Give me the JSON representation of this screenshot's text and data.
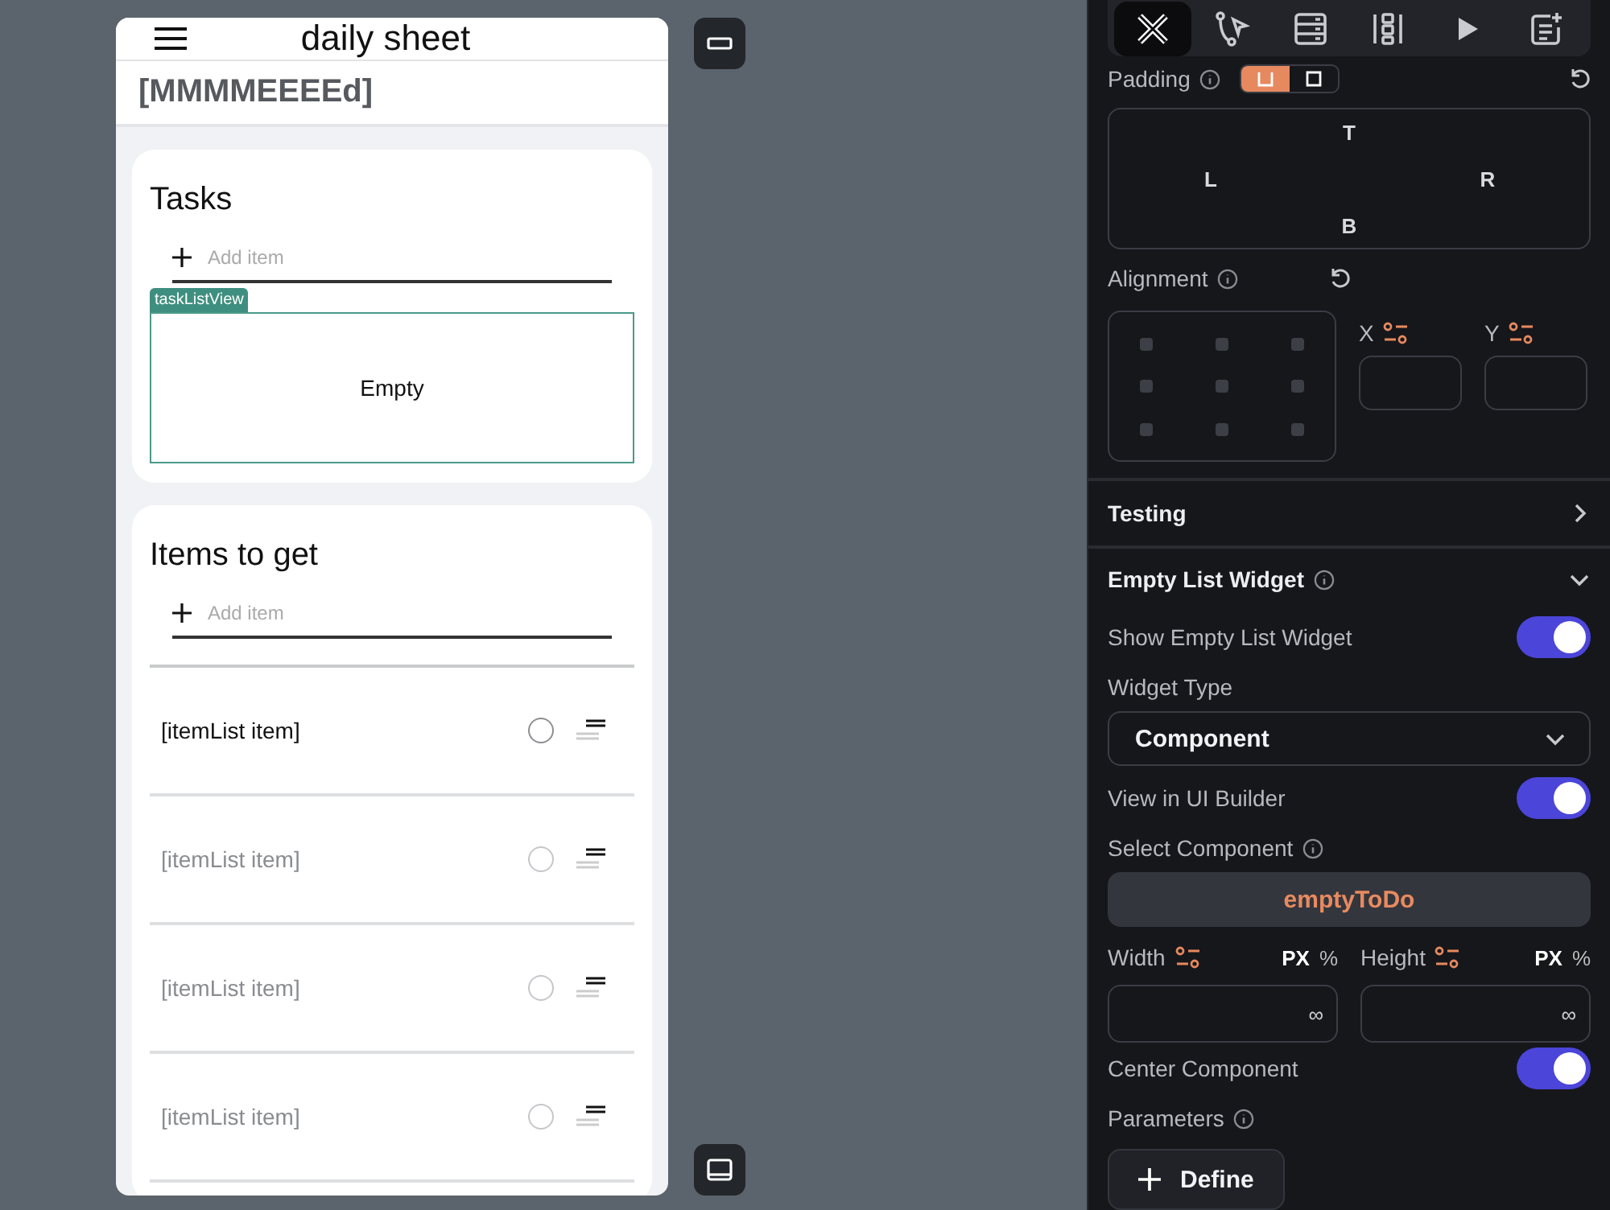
{
  "app_bar": {
    "title": "daily sheet"
  },
  "date_header": "[MMMMEEEEd]",
  "cards": [
    {
      "title": "Tasks",
      "add_placeholder": "Add item",
      "list_tag": "taskListView",
      "empty_text": "Empty"
    },
    {
      "title": "Items to get",
      "add_placeholder": "Add item",
      "items": [
        {
          "text": "[itemList item]",
          "dimmed": false,
          "checked": false
        },
        {
          "text": "[itemList item]",
          "dimmed": true,
          "checked": false
        },
        {
          "text": "[itemList item]",
          "dimmed": true,
          "checked": false
        },
        {
          "text": "[itemList item]",
          "dimmed": true,
          "checked": false
        }
      ]
    }
  ],
  "panel": {
    "toolbar": [
      {
        "kind": "widget",
        "selected": true
      },
      {
        "kind": "actions",
        "selected": false
      },
      {
        "kind": "backend",
        "selected": false
      },
      {
        "kind": "layout",
        "selected": false
      },
      {
        "kind": "run",
        "selected": false
      },
      {
        "kind": "notes",
        "selected": false
      }
    ],
    "padding": {
      "label": "Padding",
      "modes": [
        {
          "selected": true
        },
        {
          "selected": false
        }
      ],
      "sides": [
        "T",
        "B",
        "L",
        "R"
      ]
    },
    "alignment": {
      "label": "Alignment",
      "x_label": "X",
      "y_label": "Y"
    },
    "sections": [
      {
        "title": "Testing",
        "expanded": false
      },
      {
        "title": "Empty List Widget",
        "expanded": true
      }
    ],
    "rows": [
      {
        "kind": "toggle",
        "label": "Show Empty List Widget",
        "on": true
      },
      {
        "kind": "dropdown",
        "label": "Widget Type",
        "value": "Component"
      },
      {
        "kind": "toggle",
        "label": "View in UI Builder",
        "on": true
      },
      {
        "kind": "picker",
        "label": "Select Component",
        "value": "emptyToDo"
      },
      {
        "kind": "size",
        "fields": [
          {
            "label": "Width",
            "units": [
              "PX",
              "%"
            ],
            "value": "∞"
          },
          {
            "label": "Height",
            "units": [
              "PX",
              "%"
            ],
            "value": "∞"
          }
        ]
      },
      {
        "kind": "toggle",
        "label": "Center Component",
        "on": true
      },
      {
        "kind": "button",
        "label": "Parameters",
        "button": "Define"
      }
    ]
  }
}
